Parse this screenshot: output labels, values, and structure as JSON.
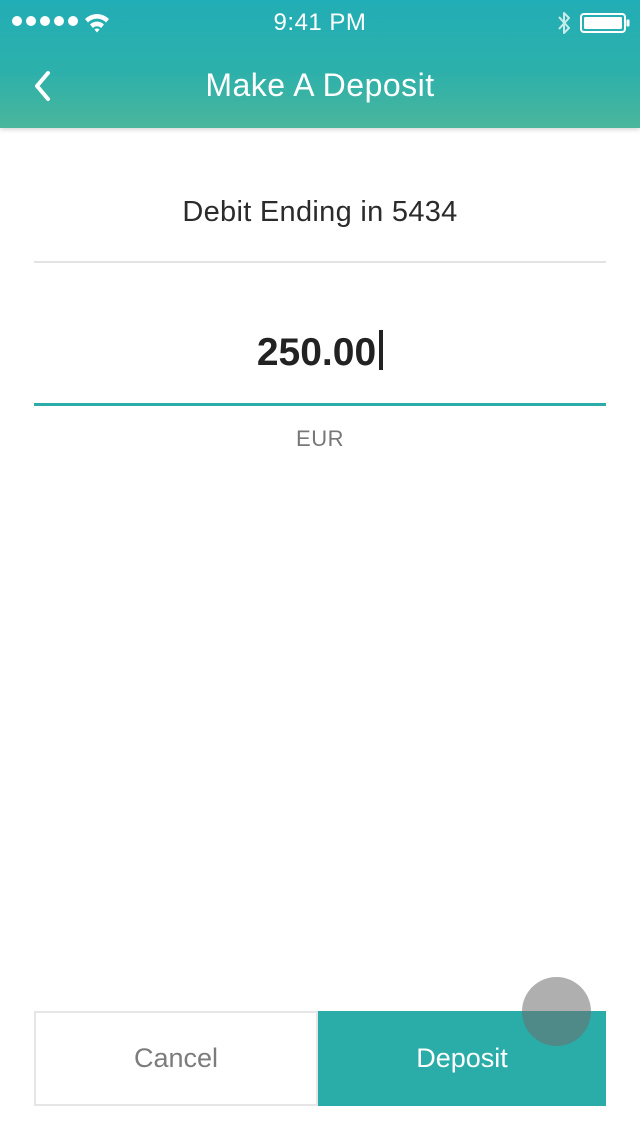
{
  "status_bar": {
    "time": "9:41 PM",
    "signal_bars": 5,
    "icons": [
      "wifi-icon",
      "bluetooth-icon",
      "battery-icon"
    ]
  },
  "nav": {
    "title": "Make A Deposit",
    "back_icon": "chevron-left-icon"
  },
  "deposit_form": {
    "account_label": "Debit Ending in 5434",
    "amount": "250.00",
    "currency": "EUR"
  },
  "actions": {
    "cancel_label": "Cancel",
    "deposit_label": "Deposit"
  },
  "colors": {
    "accent": "#2aaca9",
    "header_top": "#22aeb6",
    "header_bottom": "#4ab69c"
  }
}
